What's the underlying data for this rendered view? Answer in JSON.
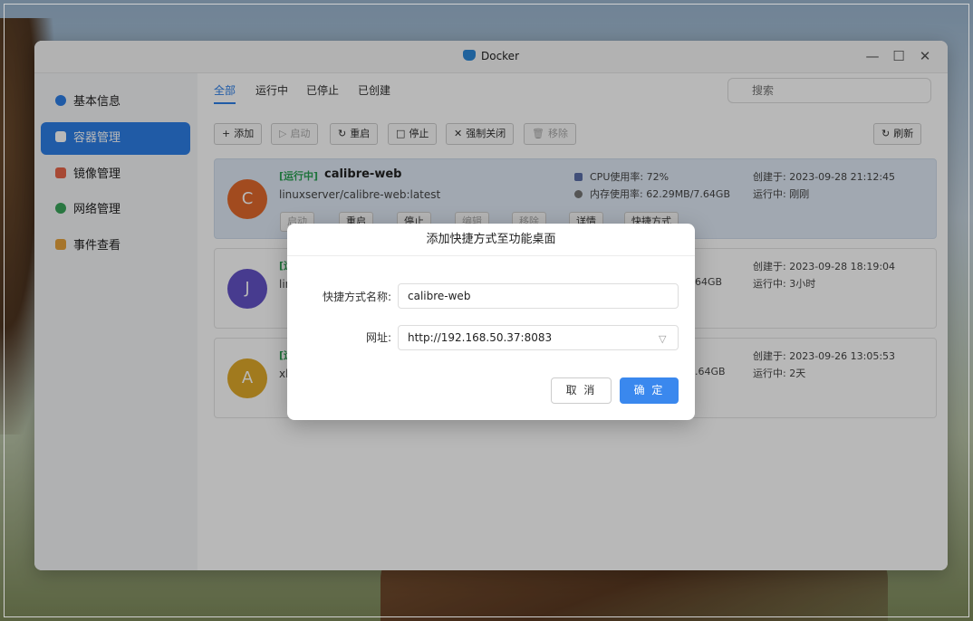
{
  "window": {
    "title": "Docker"
  },
  "sidebar": {
    "items": [
      {
        "label": "基本信息",
        "icon": "docker-icon",
        "color": "#2d7ee6"
      },
      {
        "label": "容器管理",
        "icon": "cube-icon",
        "color": "#ffffff",
        "active": true
      },
      {
        "label": "镜像管理",
        "icon": "image-icon",
        "color": "#e8664a"
      },
      {
        "label": "网络管理",
        "icon": "globe-icon",
        "color": "#3aa55a"
      },
      {
        "label": "事件查看",
        "icon": "calendar-icon",
        "color": "#e6a23c"
      }
    ]
  },
  "tabs": [
    "全部",
    "运行中",
    "已停止",
    "已创建"
  ],
  "search": {
    "placeholder": "搜索"
  },
  "toolbar": {
    "add": "添加",
    "start": "启动",
    "restart": "重启",
    "stop": "停止",
    "force_close": "强制关闭",
    "remove": "移除",
    "refresh": "刷新"
  },
  "containers": [
    {
      "avatar": "C",
      "avatar_color": "#e1692c",
      "status": "[运行中]",
      "name": "calibre-web",
      "image": "linuxserver/calibre-web:latest",
      "cpu": "CPU使用率: 72%",
      "mem": "内存使用率: 62.29MB/7.64GB",
      "created": "创建于: 2023-09-28 21:12:45",
      "running": "运行中: 刚刚",
      "buttons": [
        "启动",
        "重启",
        "停止",
        "编辑",
        "移除",
        "详情",
        "快捷方式"
      ]
    },
    {
      "avatar": "J",
      "avatar_color": "#6352c6",
      "status": "[运",
      "image": "lin",
      "mem": "64GB",
      "created": "创建于: 2023-09-28 18:19:04",
      "running": "运行中: 3小时"
    },
    {
      "avatar": "A",
      "avatar_color": "#e0a92a",
      "status": "[运",
      "image": "xb",
      "mem": "7.64GB",
      "created": "创建于: 2023-09-26 13:05:53",
      "running": "运行中: 2天"
    }
  ],
  "dialog": {
    "title": "添加快捷方式至功能桌面",
    "name_label": "快捷方式名称:",
    "name_value": "calibre-web",
    "url_label": "网址:",
    "url_value": "http://192.168.50.37:8083",
    "cancel": "取 消",
    "ok": "确 定"
  }
}
